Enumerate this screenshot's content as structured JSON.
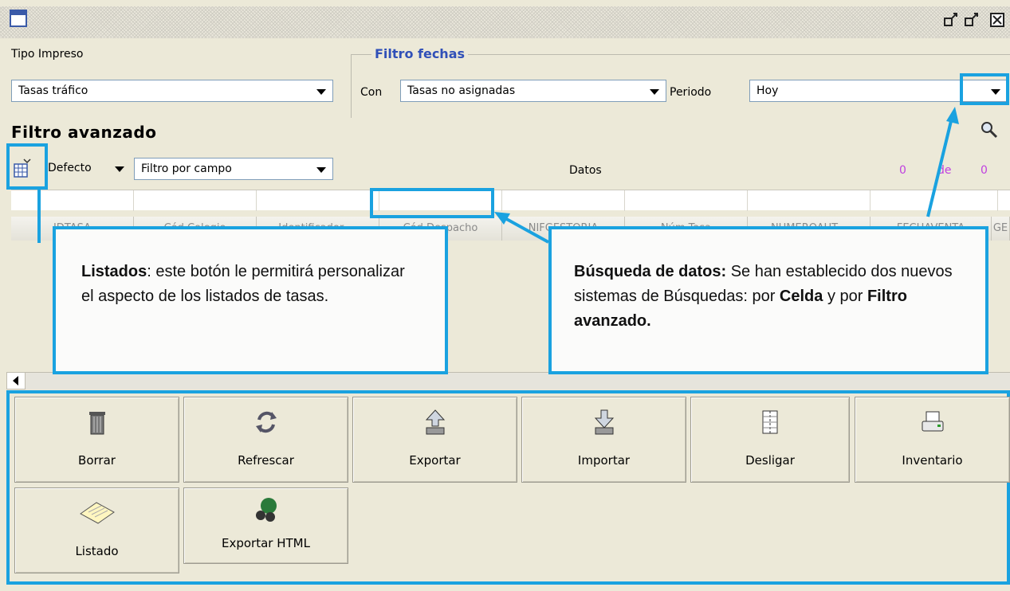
{
  "window": {
    "title_buttons": [
      "restore-icon",
      "minimize-icon",
      "close-icon"
    ]
  },
  "tipo_impreso": {
    "label": "Tipo Impreso",
    "value": "Tasas tráfico"
  },
  "filtro_fechas": {
    "title": "Filtro fechas",
    "con_label": "Con",
    "con_value": "Tasas no asignadas",
    "periodo_label": "Periodo",
    "periodo_value": "Hoy"
  },
  "filtro_avanzado": {
    "title": "Filtro avanzado",
    "defecto_label": "Defecto",
    "filtro_campo_value": "Filtro por campo",
    "datos_label": "Datos",
    "count_from": "0",
    "count_de": "de",
    "count_total": "0"
  },
  "table": {
    "columns": [
      "IDTASA",
      "Cód.Colegio",
      "Identificador ...",
      "Cód.Despacho",
      "NIFGESTORIA",
      "Núm.Tasa",
      "NUMEROAUT...",
      "FECHAVENTA",
      "GE"
    ]
  },
  "callouts": {
    "listados_bold": "Listados",
    "listados_text": ": este botón le permitirá personalizar el aspecto de los listados de tasas.",
    "busqueda_bold": "Búsqueda de datos:",
    "busqueda_text1": " Se han establecido dos nuevos sistemas de Búsquedas: por ",
    "busqueda_celda": "Celda",
    "busqueda_text2": " y por ",
    "busqueda_filtro": "Filtro avanzado."
  },
  "actions": {
    "borrar": "Borrar",
    "refrescar": "Refrescar",
    "exportar": "Exportar",
    "importar": "Importar",
    "desligar": "Desligar",
    "inventario": "Inventario",
    "listado": "Listado",
    "exportar_html": "Exportar HTML"
  },
  "colors": {
    "accent": "#1aa2e0",
    "counter": "#c040e0",
    "group_title": "#3050b8"
  }
}
